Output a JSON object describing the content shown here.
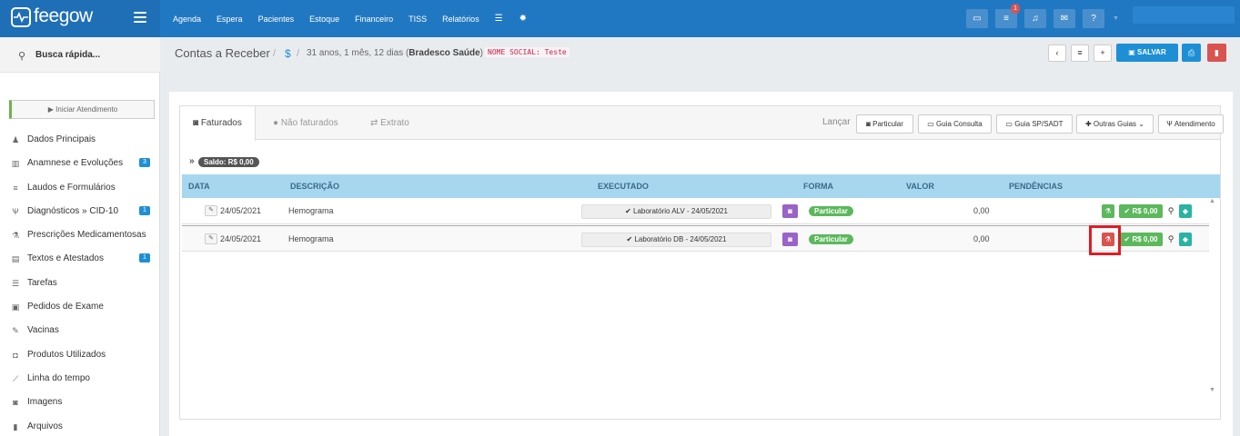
{
  "brand": {
    "name": "feegow"
  },
  "nav": {
    "items": [
      "Agenda",
      "Espera",
      "Pacientes",
      "Estoque",
      "Financeiro",
      "TISS",
      "Relatórios"
    ]
  },
  "topbar": {
    "notification_count": "1"
  },
  "sidebar": {
    "search_label": "Busca rápida...",
    "start_attendance": "▶ Iniciar Atendimento",
    "items": [
      {
        "label": "Dados Principais",
        "icon": "user-icon",
        "glyph": "♟"
      },
      {
        "label": "Anamnese e Evoluções",
        "icon": "chart-icon",
        "glyph": "▥",
        "badge": "3"
      },
      {
        "label": "Laudos e Formulários",
        "icon": "list-icon",
        "glyph": "≡"
      },
      {
        "label": "Diagnósticos » CID-10",
        "icon": "stethoscope-icon",
        "glyph": "Ѱ",
        "badge": "1"
      },
      {
        "label": "Prescrições Medicamentosas",
        "icon": "flask-icon",
        "glyph": "⚗"
      },
      {
        "label": "Textos e Atestados",
        "icon": "file-text-icon",
        "glyph": "▤",
        "badge": "1"
      },
      {
        "label": "Tarefas",
        "icon": "tasks-icon",
        "glyph": "☰"
      },
      {
        "label": "Pedidos de Exame",
        "icon": "clipboard-icon",
        "glyph": "▣"
      },
      {
        "label": "Vacinas",
        "icon": "syringe-icon",
        "glyph": "✎"
      },
      {
        "label": "Produtos Utilizados",
        "icon": "box-icon",
        "glyph": "◘"
      },
      {
        "label": "Linha do tempo",
        "icon": "timeline-icon",
        "glyph": "⟋"
      },
      {
        "label": "Imagens",
        "icon": "camera-icon",
        "glyph": "◙"
      },
      {
        "label": "Arquivos",
        "icon": "file-icon",
        "glyph": "▮"
      }
    ]
  },
  "header": {
    "title": "Contas a Receber",
    "dollar": "$",
    "age_prefix": "31 anos, 1 mês, 12 dias (",
    "insurance": "Bradesco Saúde",
    "age_suffix": ")",
    "social_name": "NOME SOCIAL: Teste",
    "save_label": "SALVAR"
  },
  "tabs": {
    "faturados": "Faturados",
    "nao_faturados": "Não faturados",
    "extrato": "Extrato"
  },
  "lancar": {
    "label": "Lançar",
    "particular": "Particular",
    "guia_consulta": "Guia Consulta",
    "guia_spsadt": "Guia SP/SADT",
    "outras_guias": "Outras Guias",
    "atendimento": "Atendimento"
  },
  "saldo": {
    "arrow": "»",
    "label": "Saldo: R$ 0,00"
  },
  "table": {
    "headers": {
      "data": "DATA",
      "descricao": "DESCRIÇÃO",
      "executado": "EXECUTADO",
      "forma": "FORMA",
      "valor": "VALOR",
      "pendencias": "PENDÊNCIAS"
    },
    "rows": [
      {
        "date": "24/05/2021",
        "description": "Hemograma",
        "executed": "✔ Laboratório ALV - 24/05/2021",
        "forma": "Particular",
        "valor": "0,00",
        "paid": "✔ R$ 0,00",
        "status_color": "#5cb85c"
      },
      {
        "date": "24/05/2021",
        "description": "Hemograma",
        "executed": "✔ Laboratório DB - 24/05/2021",
        "forma": "Particular",
        "valor": "0,00",
        "paid": "✔ R$ 0,00",
        "status_color": "#d9534f"
      }
    ]
  },
  "colors": {
    "primary": "#2178c2",
    "accent": "#1e8fd5",
    "success": "#5cb85c",
    "danger": "#d9534f",
    "table_header": "#a6d7ef"
  }
}
